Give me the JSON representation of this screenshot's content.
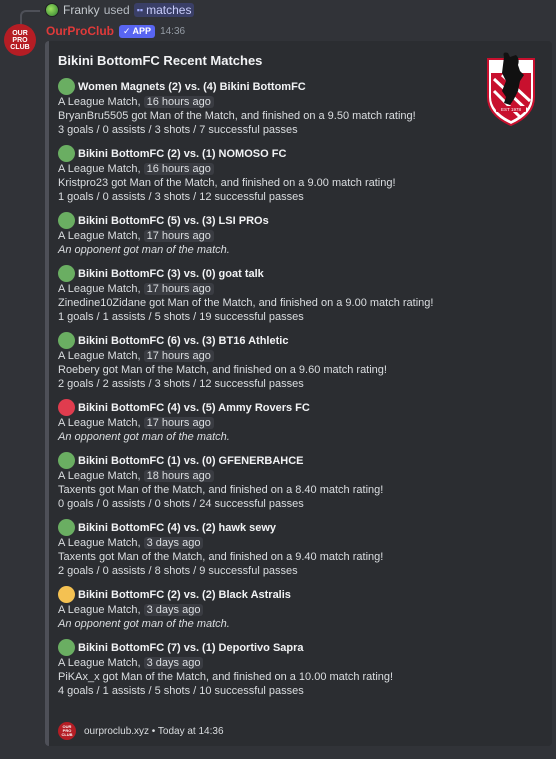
{
  "reply": {
    "user": "Franky",
    "verb": "used",
    "command": "matches"
  },
  "message": {
    "avatar_lines": [
      "OUR",
      "PRO",
      "CLUB"
    ],
    "username": "OurProClub",
    "badge": "APP",
    "time": "14:36"
  },
  "embed": {
    "title": "Bikini BottomFC Recent Matches",
    "footer_text": "ourproclub.xyz • Today at 14:36",
    "footer_logo_lines": [
      "OUR",
      "PRO",
      "CLUB"
    ],
    "crest_text": "EST 1978",
    "matches": [
      {
        "result": "win",
        "title": "Women Magnets (2) vs. (4) Bikini BottomFC",
        "type": "A League Match,",
        "when": "16 hours ago",
        "motm": "BryanBru5505 got Man of the Match, and finished on a 9.50 match rating!",
        "stats": "3 goals / 0 assists / 3 shots / 7 successful passes"
      },
      {
        "result": "win",
        "title": "Bikini BottomFC (2) vs. (1) NOMOSO FC",
        "type": "A League Match,",
        "when": "16 hours ago",
        "motm": "Kristpro23 got Man of the Match, and finished on a 9.00 match rating!",
        "stats": "1 goals / 0 assists / 3 shots / 12 successful passes"
      },
      {
        "result": "win",
        "title": "Bikini BottomFC (5) vs. (3) LSI PROs",
        "type": "A League Match,",
        "when": "17 hours ago",
        "motm": "An opponent got man of the match.",
        "stats": ""
      },
      {
        "result": "win",
        "title": "Bikini BottomFC (3) vs. (0) goat talk",
        "type": "A League Match,",
        "when": "17 hours ago",
        "motm": "Zinedine10Zidane got Man of the Match, and finished on a 9.00 match rating!",
        "stats": "1 goals / 1 assists / 5 shots / 19 successful passes"
      },
      {
        "result": "win",
        "title": "Bikini BottomFC (6) vs. (3) BT16 Athletic",
        "type": "A League Match,",
        "when": "17 hours ago",
        "motm": "Roebery got Man of the Match, and finished on a 9.60 match rating!",
        "stats": "2 goals / 2 assists / 3 shots / 12 successful passes"
      },
      {
        "result": "loss",
        "title": "Bikini BottomFC (4) vs. (5) Ammy Rovers FC",
        "type": "A League Match,",
        "when": "17 hours ago",
        "motm": "An opponent got man of the match.",
        "stats": ""
      },
      {
        "result": "win",
        "title": "Bikini BottomFC (1) vs. (0) GFENERBAHCE",
        "type": "A League Match,",
        "when": "18 hours ago",
        "motm": "Taxents got Man of the Match, and finished on a 8.40 match rating!",
        "stats": "0 goals / 0 assists / 0 shots / 24 successful passes"
      },
      {
        "result": "win",
        "title": "Bikini BottomFC (4) vs. (2) hawk sewy",
        "type": "A League Match,",
        "when": "3 days ago",
        "motm": "Taxents got Man of the Match, and finished on a 9.40 match rating!",
        "stats": "2 goals / 0 assists / 8 shots / 9 successful passes"
      },
      {
        "result": "draw",
        "title": "Bikini BottomFC (2) vs. (2) Black Astralis",
        "type": "A League Match,",
        "when": "3 days ago",
        "motm": "An opponent got man of the match.",
        "stats": ""
      },
      {
        "result": "win",
        "title": "Bikini BottomFC (7) vs. (1) Deportivo Sapra",
        "type": "A League Match,",
        "when": "3 days ago",
        "motm": "PiKAx_x got Man of the Match, and finished on a 10.00 match rating!",
        "stats": "4 goals / 1 assists / 5 shots / 10 successful passes"
      }
    ]
  },
  "colors": {
    "win": "#6aae62",
    "loss": "#e03c4e",
    "draw": "#f4c152",
    "username": "#e03a3a",
    "app_badge": "#5865f2"
  }
}
